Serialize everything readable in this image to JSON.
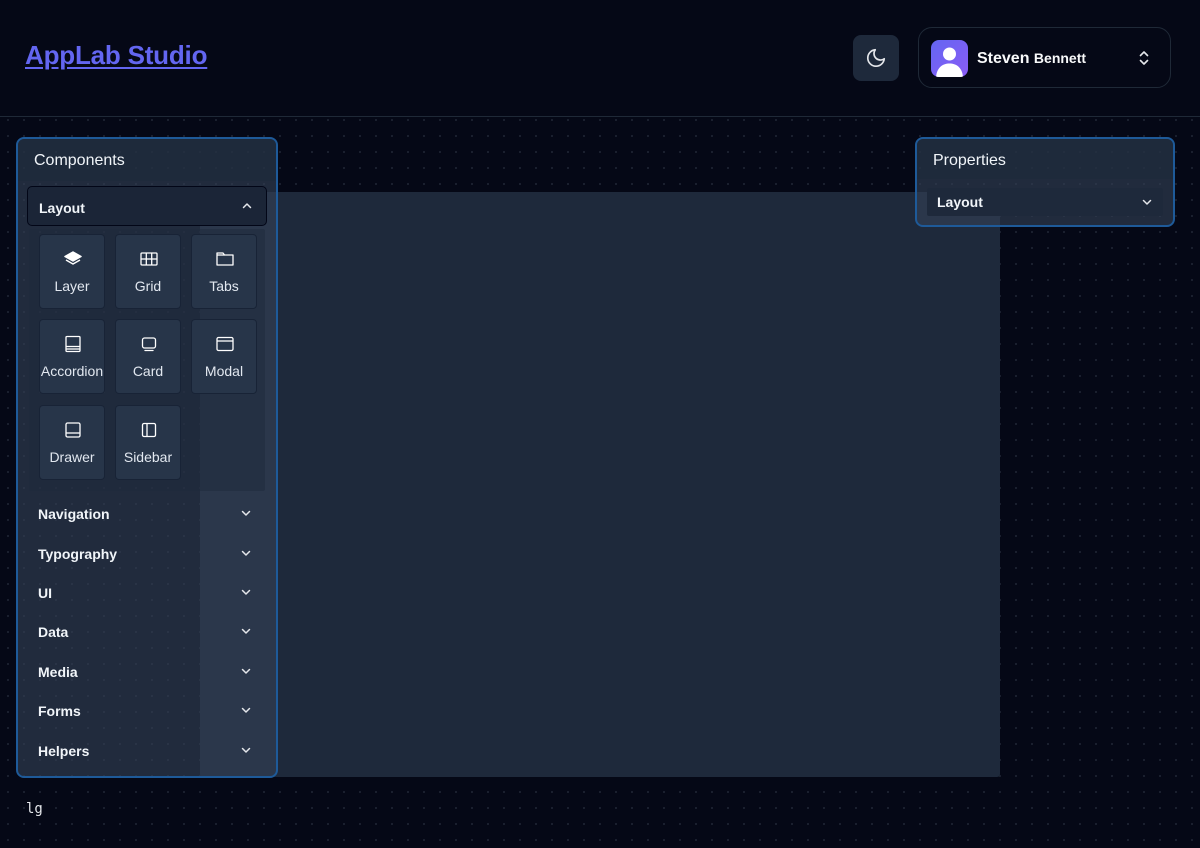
{
  "header": {
    "app_title": "AppLab Studio",
    "theme_toggle_icon": "moon-icon",
    "user": {
      "first_name": "Steven",
      "last_name": "Bennett",
      "avatar_icon": "user-avatar-icon",
      "menu_icon": "chevron-up-down-icon"
    }
  },
  "components_panel": {
    "title": "Components",
    "open_section": {
      "label": "Layout",
      "icon": "chevron-up-icon",
      "items": [
        {
          "label": "Layer",
          "icon": "layers-icon"
        },
        {
          "label": "Grid",
          "icon": "grid-icon"
        },
        {
          "label": "Tabs",
          "icon": "folder-tab-icon"
        },
        {
          "label": "Accordion",
          "icon": "accordion-icon"
        },
        {
          "label": "Card",
          "icon": "card-icon"
        },
        {
          "label": "Modal",
          "icon": "window-icon"
        },
        {
          "label": "Drawer",
          "icon": "drawer-icon"
        },
        {
          "label": "Sidebar",
          "icon": "sidebar-icon"
        }
      ]
    },
    "sections": [
      {
        "label": "Navigation",
        "icon": "chevron-down-icon"
      },
      {
        "label": "Typography",
        "icon": "chevron-down-icon"
      },
      {
        "label": "UI",
        "icon": "chevron-down-icon"
      },
      {
        "label": "Data",
        "icon": "chevron-down-icon"
      },
      {
        "label": "Media",
        "icon": "chevron-down-icon"
      },
      {
        "label": "Forms",
        "icon": "chevron-down-icon"
      },
      {
        "label": "Helpers",
        "icon": "chevron-down-icon"
      }
    ]
  },
  "properties_panel": {
    "title": "Properties",
    "select": {
      "value": "Layout",
      "icon": "chevron-down-icon"
    }
  },
  "footer": {
    "breakpoint": "lg"
  },
  "colors": {
    "accent": "#6366f1",
    "panel_border": "#1e5a99",
    "background": "#050816",
    "canvas": "#1e293b"
  }
}
